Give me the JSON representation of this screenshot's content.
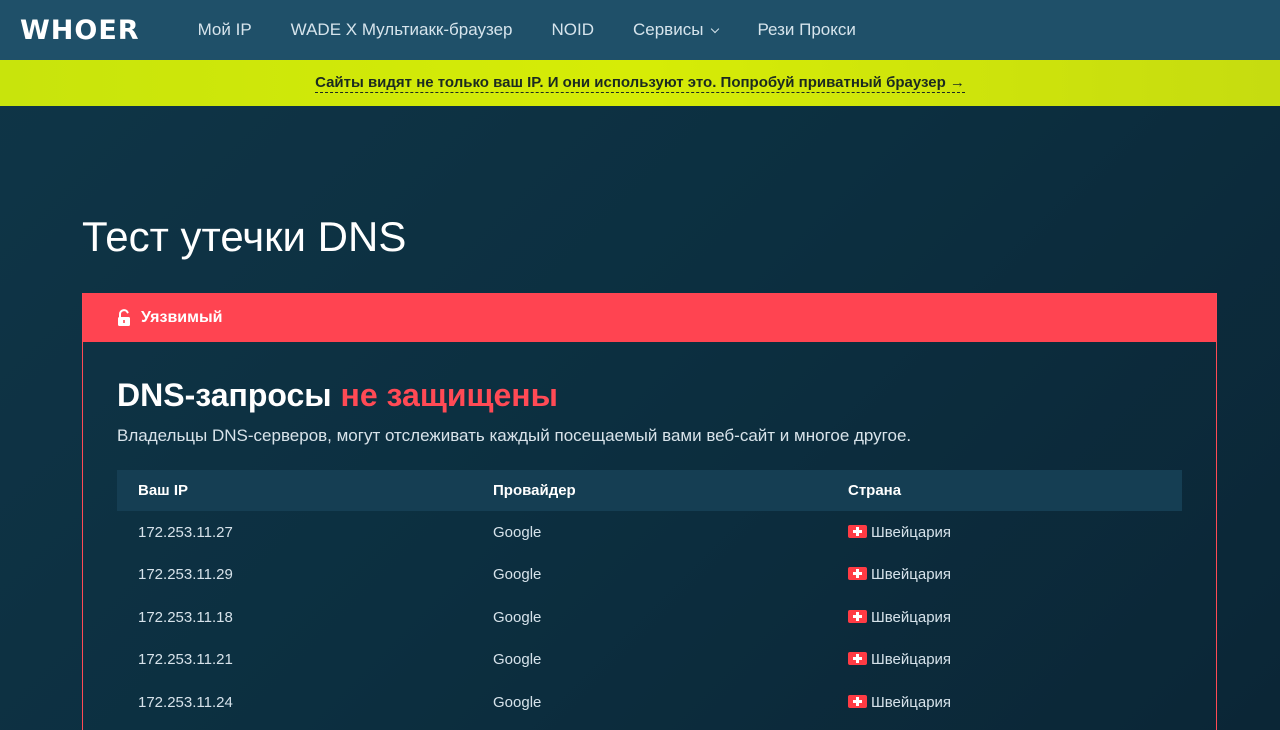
{
  "header": {
    "logo": "WHOER",
    "nav": [
      {
        "label": "Мой IP"
      },
      {
        "label": "WADE X Мультиакк-браузер"
      },
      {
        "label": "NOID"
      },
      {
        "label": "Сервисы"
      },
      {
        "label": "Рези Прокси"
      }
    ]
  },
  "promo": {
    "text": "Сайты видят не только ваш IP. И они используют это. Попробуй приватный браузер →"
  },
  "page": {
    "title": "Тест утечки DNS"
  },
  "status_card": {
    "status_label": "Уязвимый",
    "headline_prefix": "DNS-запросы",
    "headline_highlight": "не защищены",
    "description": "Владельцы DNS-серверов, могут отслеживать каждый посещаемый вами веб-сайт и многое другое.",
    "accent_color": "#ff4451",
    "table": {
      "columns": [
        "Ваш IP",
        "Провайдер",
        "Страна"
      ],
      "rows": [
        {
          "ip": "172.253.11.27",
          "provider": "Google",
          "country": "Швейцария"
        },
        {
          "ip": "172.253.11.29",
          "provider": "Google",
          "country": "Швейцария"
        },
        {
          "ip": "172.253.11.18",
          "provider": "Google",
          "country": "Швейцария"
        },
        {
          "ip": "172.253.11.21",
          "provider": "Google",
          "country": "Швейцария"
        },
        {
          "ip": "172.253.11.24",
          "provider": "Google",
          "country": "Швейцария"
        }
      ]
    }
  }
}
